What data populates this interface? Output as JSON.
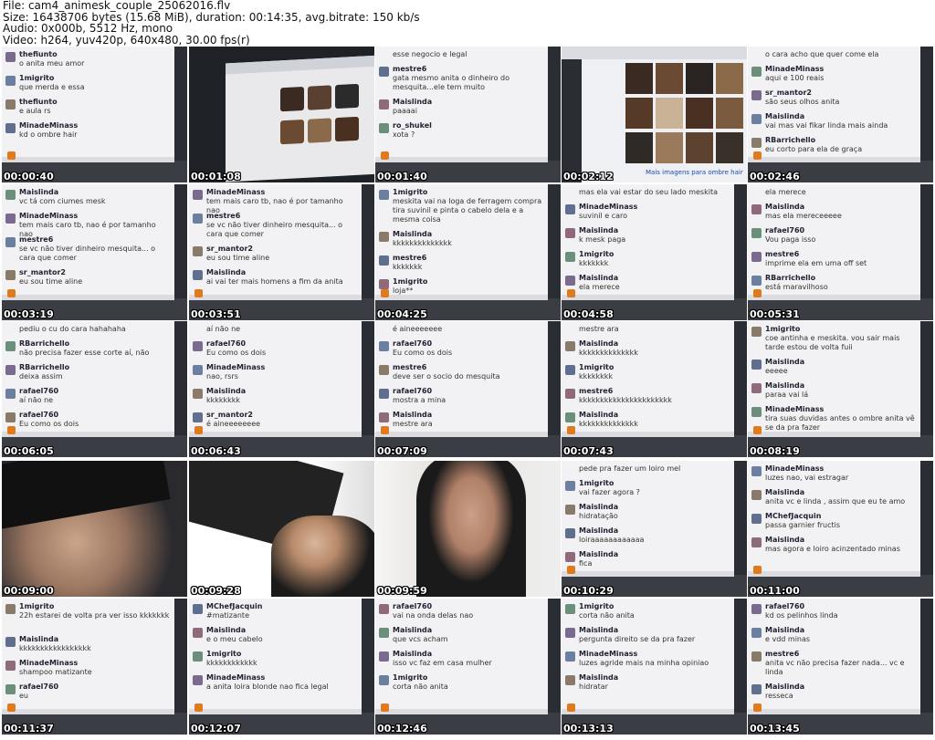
{
  "header": {
    "file": "File: cam4_animesk_couple_25062016.flv",
    "size": "Size: 16438706 bytes (15.68 MiB), duration: 00:14:35, avg.bitrate: 150 kb/s",
    "audio": "Audio: 0x000b, 5512 Hz, mono",
    "video": "Video: h264, yuv420p, 640x480, 30.00 fps(r)"
  },
  "thumbnails": [
    {
      "ts": "00:00:40",
      "kind": "chat",
      "msgs": [
        [
          "thefiunto",
          "o anita meu amor"
        ],
        [
          "1migrito",
          "que merda e essa"
        ],
        [
          "thefiunto",
          "e aula rs"
        ],
        [
          "MinadeMinass",
          "kd o ombre hair"
        ]
      ]
    },
    {
      "ts": "00:01:08",
      "kind": "browser"
    },
    {
      "ts": "00:01:40",
      "kind": "chat",
      "msgs": [
        [
          "",
          "esse negocio e legal"
        ],
        [
          "mestre6",
          "gata mesmo anita o dinheiro do mesquita...ele tem muito"
        ],
        [
          "Maislinda",
          "paaaai"
        ],
        [
          "ro_shukel",
          "xota ?"
        ]
      ]
    },
    {
      "ts": "00:02:12",
      "kind": "browser2",
      "caption": "Mais imagens para ombre hair"
    },
    {
      "ts": "00:02:46",
      "kind": "chat",
      "msgs": [
        [
          "",
          "o cara acho que quer come ela"
        ],
        [
          "MinadeMinass",
          "aqui e 100 reais"
        ],
        [
          "sr_mantor2",
          "são seus olhos anita"
        ],
        [
          "Maislinda",
          "vai mas vai fikar linda mais ainda"
        ],
        [
          "RBarrichello",
          "eu corto para ela de graça"
        ]
      ]
    },
    {
      "ts": "00:03:19",
      "kind": "chat",
      "msgs": [
        [
          "Maislinda",
          "vc tá com ciumes mesk"
        ],
        [
          "MinadeMinass",
          "tem mais caro tb, nao é por tamanho nao"
        ],
        [
          "mestre6",
          "se vc não tiver dinheiro mesquita... o cara que comer"
        ],
        [
          "sr_mantor2",
          "eu sou time aline"
        ]
      ]
    },
    {
      "ts": "00:03:51",
      "kind": "chat",
      "msgs": [
        [
          "MinadeMinass",
          "tem mais caro tb, nao é por tamanho nao"
        ],
        [
          "mestre6",
          "se vc não tiver dinheiro mesquita... o cara que comer"
        ],
        [
          "sr_mantor2",
          "eu sou time aline"
        ],
        [
          "Maislinda",
          "ai vai ter mais homens  a fim da anita"
        ]
      ]
    },
    {
      "ts": "00:04:25",
      "kind": "chat",
      "msgs": [
        [
          "1migrito",
          "meskita vai na loga de ferragem compra tira suvinil e pinta o cabelo dela e a mesma coisa"
        ],
        [
          "Maislinda",
          "kkkkkkkkkkkkkk"
        ],
        [
          "mestre6",
          "kkkkkkk"
        ],
        [
          "1migrito",
          "loja**"
        ]
      ]
    },
    {
      "ts": "00:04:58",
      "kind": "chat",
      "msgs": [
        [
          "",
          "mas ela vai estar do seu lado meskita"
        ],
        [
          "MinadeMinass",
          "suvinil e caro"
        ],
        [
          "Maislinda",
          "k mesk paga"
        ],
        [
          "1migrito",
          "kkkkkkk"
        ],
        [
          "Maislinda",
          "ela merece"
        ]
      ]
    },
    {
      "ts": "00:05:31",
      "kind": "chat",
      "msgs": [
        [
          "",
          "ela merece"
        ],
        [
          "Maislinda",
          "mas ela mereceeeee"
        ],
        [
          "rafael760",
          "Vou paga isso"
        ],
        [
          "mestre6",
          "imprime ela em uma off set"
        ],
        [
          "RBarrichello",
          "está maravilhoso"
        ]
      ]
    },
    {
      "ts": "00:06:05",
      "kind": "chat",
      "msgs": [
        [
          "",
          "pediu o cu do cara hahahaha"
        ],
        [
          "RBarrichello",
          "não precisa fazer esse corte aí, não"
        ],
        [
          "RBarrichello",
          "deixa assim"
        ],
        [
          "rafael760",
          "aí não  ne"
        ],
        [
          "rafael760",
          "Eu como os dois"
        ]
      ]
    },
    {
      "ts": "00:06:43",
      "kind": "chat",
      "msgs": [
        [
          "",
          "aí não  ne"
        ],
        [
          "rafael760",
          "Eu como os dois"
        ],
        [
          "MinadeMinass",
          "nao, rsrs"
        ],
        [
          "Maislinda",
          "kkkkkkkk"
        ],
        [
          "sr_mantor2",
          "é aineeeeeeee"
        ]
      ]
    },
    {
      "ts": "00:07:09",
      "kind": "chat",
      "msgs": [
        [
          "",
          "é aineeeeeee"
        ],
        [
          "rafael760",
          "Eu como os dois"
        ],
        [
          "mestre6",
          "deve ser o socio do mesquita"
        ],
        [
          "rafael760",
          "mostra a mina"
        ],
        [
          "Maislinda",
          "mestre ara"
        ]
      ]
    },
    {
      "ts": "00:07:43",
      "kind": "chat",
      "msgs": [
        [
          "",
          "mestre ara"
        ],
        [
          "Maislinda",
          "kkkkkkkkkkkkkk"
        ],
        [
          "1migrito",
          "kkkkkkkk"
        ],
        [
          "mestre6",
          "kkkkkkkkkkkkkkkkkkkkkk"
        ],
        [
          "Maislinda",
          "kkkkkkkkkkkkkk"
        ]
      ]
    },
    {
      "ts": "00:08:19",
      "kind": "chat",
      "msgs": [
        [
          "1migrito",
          "coe antinha e meskita. vou sair mais tarde estou de volta fuii"
        ],
        [
          "Maislinda",
          "eeeee"
        ],
        [
          "Maislinda",
          "paraa vai lá"
        ],
        [
          "MinadeMinass",
          "tira suas duvidas antes o ombre anita vê se da pra fazer"
        ]
      ]
    },
    {
      "ts": "00:09:00",
      "kind": "cam1"
    },
    {
      "ts": "00:09:28",
      "kind": "cam2"
    },
    {
      "ts": "00:09:59",
      "kind": "cam3"
    },
    {
      "ts": "00:10:29",
      "kind": "chat",
      "msgs": [
        [
          "",
          "pede pra fazer um loiro mel"
        ],
        [
          "1migrito",
          "vai fazer agora ?"
        ],
        [
          "Maislinda",
          "hidratação"
        ],
        [
          "Maislinda",
          "loiraaaaaaaaaaaa"
        ],
        [
          "Maislinda",
          "fica"
        ]
      ]
    },
    {
      "ts": "00:11:00",
      "kind": "chat",
      "msgs": [
        [
          "MinadeMinass",
          "luzes nao, vai estragar"
        ],
        [
          "Maislinda",
          "anita vc e linda , assim que eu te amo"
        ],
        [
          "MChefJacquin",
          "passa garnier fructis"
        ],
        [
          "Maislinda",
          "mas agora e loiro acinzentado minas"
        ]
      ]
    },
    {
      "ts": "00:11:37",
      "kind": "chat",
      "msgs": [
        [
          "1migrito",
          "22h estarei de volta pra ver isso kkkkkkk"
        ],
        [
          "Maislinda",
          "kkkkkkkkkkkkkkkkk"
        ],
        [
          "MinadeMinass",
          "shampoo matizante"
        ],
        [
          "rafael760",
          "eu"
        ]
      ]
    },
    {
      "ts": "00:12:07",
      "kind": "chat",
      "msgs": [
        [
          "MChefJacquin",
          "#matizante"
        ],
        [
          "Maislinda",
          "e o meu cabelo"
        ],
        [
          "1migrito",
          "kkkkkkkkkkkk"
        ],
        [
          "MinadeMinass",
          "a anita loira blonde nao fica legal"
        ]
      ]
    },
    {
      "ts": "00:12:46",
      "kind": "chat",
      "msgs": [
        [
          "rafael760",
          "vai na onda delas nao"
        ],
        [
          "Maislinda",
          "que vcs acham"
        ],
        [
          "Maislinda",
          "isso vc faz em casa mulher"
        ],
        [
          "1migrito",
          "corta não anita"
        ]
      ]
    },
    {
      "ts": "00:13:13",
      "kind": "chat",
      "msgs": [
        [
          "1migrito",
          "corta não anita"
        ],
        [
          "Maislinda",
          "pergunta direito se da pra fazer"
        ],
        [
          "MinadeMinass",
          "luzes agride mais na minha opiniao"
        ],
        [
          "Maislinda",
          "hidratar"
        ]
      ]
    },
    {
      "ts": "00:13:45",
      "kind": "chat",
      "msgs": [
        [
          "rafael760",
          "kd os pelinhos linda"
        ],
        [
          "Maislinda",
          "e vdd minas"
        ],
        [
          "mestre6",
          "anita vc não precisa fazer nada... vc e linda"
        ],
        [
          "Maislinda",
          "resseca"
        ]
      ]
    }
  ]
}
